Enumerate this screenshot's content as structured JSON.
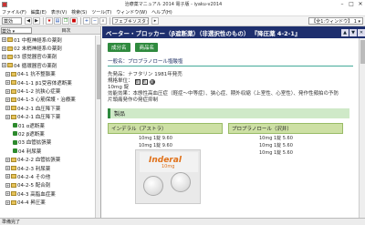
{
  "window": {
    "title": "治療薬マニュアル 2014 電子版 - iyaku-v2014",
    "min": "–",
    "max": "□",
    "close": "✕"
  },
  "menu": [
    "ファイル(F)",
    "編集(E)",
    "表示(V)",
    "検索(S)",
    "ツール(T)",
    "ウィンドウ(W)",
    "ヘルプ(H)"
  ],
  "toolbar": {
    "select": "薬効",
    "field": "フェブキソスタット",
    "right": "【全1:ウィンドウ】 1 ▾"
  },
  "left_pane": {
    "selector": "薬効 ▾",
    "title": "目次"
  },
  "tree": [
    {
      "kind": "folder",
      "label": "01 中枢神経系の薬剤"
    },
    {
      "kind": "folder",
      "label": "02 末梢神経系の薬剤"
    },
    {
      "kind": "folder",
      "label": "03 感覚器官の薬剤"
    },
    {
      "kind": "folder",
      "label": "04 循環器官の薬剤"
    },
    {
      "kind": "folder",
      "label": "04-1 抗不整脈薬"
    },
    {
      "kind": "folder",
      "label": "04-1-1 β1受容体遮断薬"
    },
    {
      "kind": "folder",
      "label": "04-1-2 抗狭心症薬"
    },
    {
      "kind": "folder",
      "label": "04-1-3 心筋保護・治療薬"
    },
    {
      "kind": "folder",
      "label": "04-2-1 血圧降下薬"
    },
    {
      "kind": "folder",
      "label": "04-2-1 血圧降下薬"
    },
    {
      "kind": "leaf",
      "label": "01 α遮断薬"
    },
    {
      "kind": "leaf",
      "label": "02 β遮断薬"
    },
    {
      "kind": "leaf",
      "label": "03 血管拡張薬"
    },
    {
      "kind": "leaf",
      "label": "04 利尿薬"
    },
    {
      "kind": "folder",
      "label": "04-2-2 血管拡張薬"
    },
    {
      "kind": "folder",
      "label": "04-2-3 利尿薬"
    },
    {
      "kind": "folder",
      "label": "04-2-4 その他"
    },
    {
      "kind": "folder",
      "label": "04-2-5 配合剤"
    },
    {
      "kind": "folder",
      "label": "04-3 高脂血症薬"
    },
    {
      "kind": "folder",
      "label": "04-4 昇圧薬"
    }
  ],
  "detail": {
    "header": "ベーター・ブロッカー（β遮断薬）（非選択性のもの） 『降圧薬 4-2-1』",
    "nav": [
      "▲",
      "▼",
      "✕"
    ],
    "tabs": [
      "成分名",
      "商品名"
    ],
    "section": "一般名：プロプラノロール塩酸塩",
    "info_lines": [
      "先発品：ナフタリン 1981年発売",
      "規格単位：",
      "10mg 錠",
      "効能効果：本態性高血圧症（軽症〜中等症）、狭心症、期外収縮（上室性、心室性）、発作性頻拍の予防",
      "片頭痛発作の発症抑制"
    ],
    "badges": [
      "劇",
      "処",
      "錠"
    ],
    "product_label": "製品",
    "col1": {
      "head": "インデラル（アストラ）",
      "lines": [
        "10mg 1錠 9.60",
        "10mg 1錠 9.60",
        "10mg 1錠 9.60"
      ]
    },
    "col2": {
      "head": "プロプラノロール（沢井）",
      "lines": [
        "10mg 1錠 5.60",
        "10mg 1錠 5.60",
        "10mg 1錠 5.60"
      ]
    },
    "photo": {
      "brand": "Inderal",
      "dose": "10mg"
    }
  },
  "status": "準備完了"
}
